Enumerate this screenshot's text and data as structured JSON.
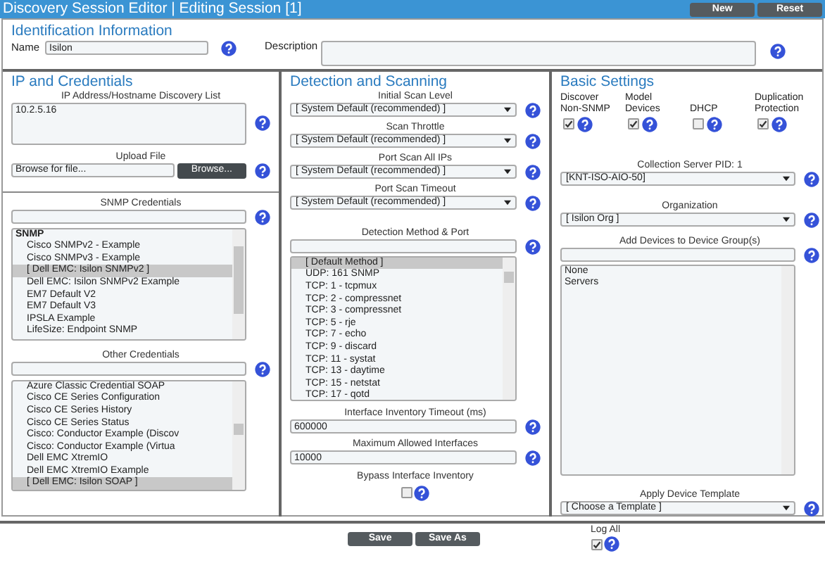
{
  "window": {
    "title": "Discovery Session Editor | Editing Session [1]"
  },
  "header_buttons": [
    "New",
    "Reset"
  ],
  "identification": {
    "title": "Identification Information",
    "name": {
      "label": "Name",
      "value": "Isilon"
    },
    "description": {
      "label": "Description"
    }
  },
  "ip_credentials": {
    "title": "IP and Credentials",
    "discovery_list": {
      "label": "IP Address/Hostname Discovery List",
      "value": "10.2.5.16"
    },
    "upload_file": {
      "label": "Upload File",
      "value": "Browse for file...",
      "button": "Browse..."
    },
    "snmp_credentials": {
      "label": "SNMP Credentials",
      "items": [
        {
          "text": "SNMP",
          "kind": "header",
          "selected": false
        },
        {
          "text": "Cisco SNMPv2 - Example",
          "kind": "item",
          "selected": false
        },
        {
          "text": "Cisco SNMPv3 - Example",
          "kind": "item",
          "selected": false
        },
        {
          "text": "[ Dell EMC: Isilon SNMPv2 ]",
          "kind": "item",
          "selected": true
        },
        {
          "text": "Dell EMC: Isilon SNMPv2 Example",
          "kind": "item",
          "selected": false
        },
        {
          "text": "EM7 Default V2",
          "kind": "item",
          "selected": false
        },
        {
          "text": "EM7 Default V3",
          "kind": "item",
          "selected": false
        },
        {
          "text": "IPSLA Example",
          "kind": "item",
          "selected": false
        },
        {
          "text": "LifeSize: Endpoint SNMP",
          "kind": "item",
          "selected": false
        }
      ]
    },
    "other_credentials": {
      "label": "Other Credentials",
      "items": [
        {
          "text": "Azure Classic Credential SOAP",
          "selected": false
        },
        {
          "text": "Cisco CE Series Configuration",
          "selected": false
        },
        {
          "text": "Cisco CE Series History",
          "selected": false
        },
        {
          "text": "Cisco CE Series Status",
          "selected": false
        },
        {
          "text": "Cisco: Conductor Example (Discov",
          "selected": false
        },
        {
          "text": "Cisco: Conductor Example (Virtua",
          "selected": false
        },
        {
          "text": "Dell EMC XtremIO",
          "selected": false
        },
        {
          "text": "Dell EMC XtremIO Example",
          "selected": false
        },
        {
          "text": "[ Dell EMC: Isilon SOAP ]",
          "selected": true
        }
      ]
    }
  },
  "detection": {
    "title": "Detection and Scanning",
    "selects": [
      {
        "label": "Initial Scan Level",
        "value": "[ System Default (recommended) ]"
      },
      {
        "label": "Scan Throttle",
        "value": "[ System Default (recommended) ]"
      },
      {
        "label": "Port Scan All IPs",
        "value": "[ System Default (recommended) ]"
      },
      {
        "label": "Port Scan Timeout",
        "value": "[ System Default (recommended) ]"
      }
    ],
    "detection_method": {
      "label": "Detection Method & Port",
      "items": [
        {
          "text": "[ Default Method ]",
          "selected": true
        },
        {
          "text": "UDP: 161 SNMP",
          "selected": false
        },
        {
          "text": "TCP: 1 - tcpmux",
          "selected": false
        },
        {
          "text": "TCP: 2 - compressnet",
          "selected": false
        },
        {
          "text": "TCP: 3 - compressnet",
          "selected": false
        },
        {
          "text": "TCP: 5 - rje",
          "selected": false
        },
        {
          "text": "TCP: 7 - echo",
          "selected": false
        },
        {
          "text": "TCP: 9 - discard",
          "selected": false
        },
        {
          "text": "TCP: 11 - systat",
          "selected": false
        },
        {
          "text": "TCP: 13 - daytime",
          "selected": false
        },
        {
          "text": "TCP: 15 - netstat",
          "selected": false
        },
        {
          "text": "TCP: 17 - qotd",
          "selected": false
        }
      ]
    },
    "interface_timeout": {
      "label": "Interface Inventory Timeout (ms)",
      "value": "600000"
    },
    "max_interfaces": {
      "label": "Maximum Allowed Interfaces",
      "value": "10000"
    },
    "bypass_inventory": {
      "label": "Bypass Interface Inventory",
      "checked": false
    }
  },
  "basic_settings": {
    "title": "Basic Settings",
    "options": [
      {
        "label": "Discover Non-SNMP",
        "checked": true
      },
      {
        "label": "Model Devices",
        "checked": true
      },
      {
        "label": "DHCP",
        "checked": false
      },
      {
        "label": "Duplication Protection",
        "checked": true
      }
    ],
    "collection_server": {
      "label": "Collection Server PID: 1",
      "value": "[KNT-ISO-AIO-50]"
    },
    "organization": {
      "label": "Organization",
      "value": "[ Isilon Org ]"
    },
    "device_groups": {
      "label": "Add Devices to Device Group(s)",
      "items": [
        {
          "text": "None",
          "selected": false
        },
        {
          "text": "Servers",
          "selected": false
        }
      ]
    },
    "device_template": {
      "label": "Apply Device Template",
      "value": "[ Choose a Template ]"
    }
  },
  "footer": {
    "buttons": [
      "Save",
      "Save As"
    ],
    "log_all": {
      "label": "Log All",
      "checked": true
    }
  }
}
